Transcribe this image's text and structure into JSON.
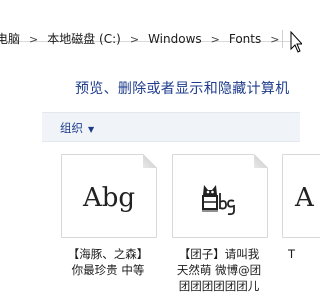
{
  "address": {
    "crumbs": [
      "电脑",
      "本地磁盘 (C:)",
      "Windows",
      "Fonts"
    ],
    "separator": ">"
  },
  "heading": "预览、删除或者显示和隐藏计算机",
  "toolbar": {
    "organize_label": "组织"
  },
  "fonts": [
    {
      "sample": "Abg",
      "line1": "【海豚、之森】",
      "line2": "你最珍贵 中等"
    },
    {
      "sample": "",
      "line1": "【团子】请叫我",
      "line2": "天然萌 微博@团",
      "line3": "团团团团团团儿"
    },
    {
      "sample": "A",
      "line1": "T",
      "line2": ""
    }
  ],
  "colors": {
    "accent": "#1e3c8c",
    "toolbar_bg": "#f0f4f9"
  }
}
